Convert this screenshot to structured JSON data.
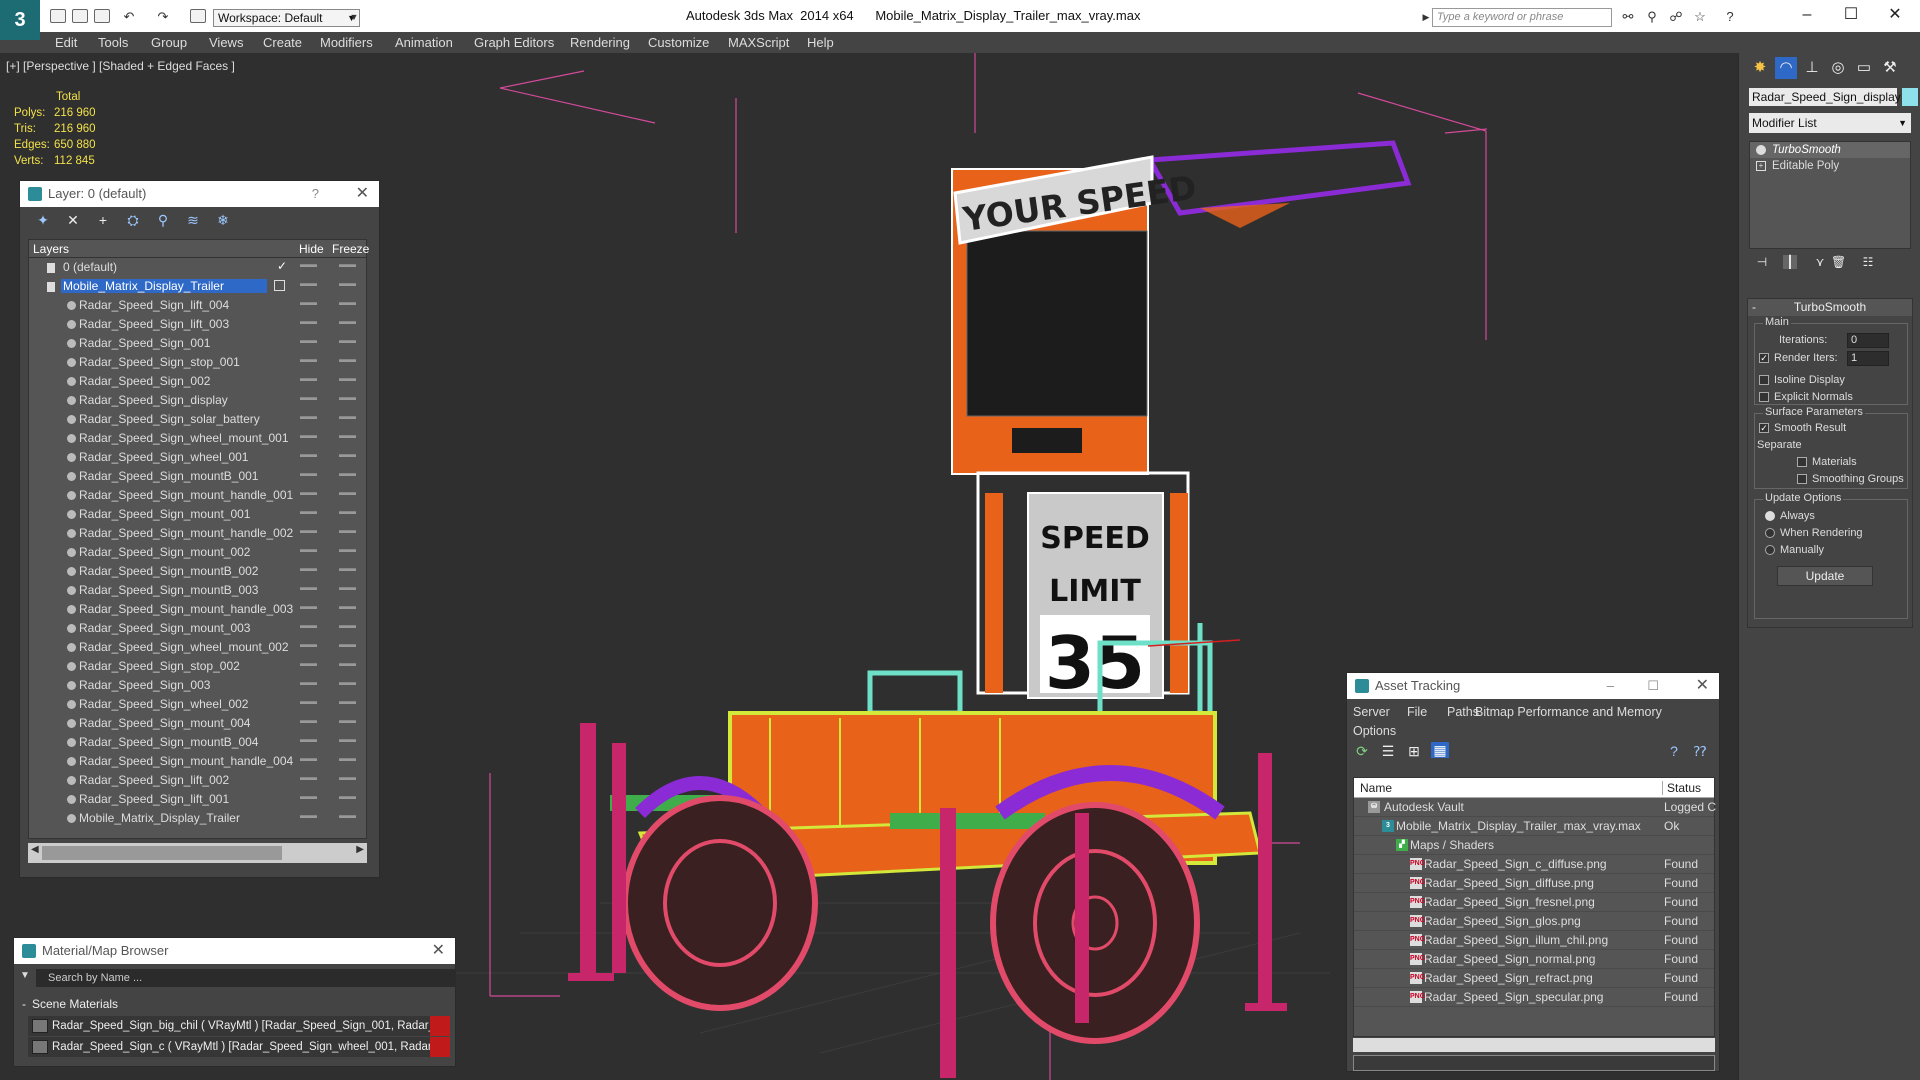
{
  "titlebar": {
    "workspace": "Workspace: Default",
    "app_name": "Autodesk 3ds Max  2014 x64",
    "file_name": "Mobile_Matrix_Display_Trailer_max_vray.max",
    "search_placeholder": "Type a keyword or phrase"
  },
  "menu": [
    "Edit",
    "Tools",
    "Group",
    "Views",
    "Create",
    "Modifiers",
    "Animation",
    "Graph Editors",
    "Rendering",
    "Customize",
    "MAXScript",
    "Help"
  ],
  "viewport": {
    "label": "[+] [Perspective ] [Shaded + Edged Faces ]",
    "stats": {
      "header": "Total",
      "polys_label": "Polys:",
      "polys": "216 960",
      "tris_label": "Tris:",
      "tris": "216 960",
      "edges_label": "Edges:",
      "edges": "650 880",
      "verts_label": "Verts:",
      "verts": "112 845"
    },
    "sign_top": "YOUR SPEED",
    "sign_limit_1": "SPEED",
    "sign_limit_2": "LIMIT",
    "sign_number": "35"
  },
  "layer_panel": {
    "title": "Layer: 0 (default)",
    "help": "?",
    "col_layers": "Layers",
    "col_hide": "Hide",
    "col_freeze": "Freeze",
    "layers": [
      {
        "name": "0 (default)"
      },
      {
        "name": "Mobile_Matrix_Display_Trailer"
      }
    ],
    "objects": [
      "Radar_Speed_Sign_lift_004",
      "Radar_Speed_Sign_lift_003",
      "Radar_Speed_Sign_001",
      "Radar_Speed_Sign_stop_001",
      "Radar_Speed_Sign_002",
      "Radar_Speed_Sign_display",
      "Radar_Speed_Sign_solar_battery",
      "Radar_Speed_Sign_wheel_mount_001",
      "Radar_Speed_Sign_wheel_001",
      "Radar_Speed_Sign_mountB_001",
      "Radar_Speed_Sign_mount_handle_001",
      "Radar_Speed_Sign_mount_001",
      "Radar_Speed_Sign_mount_handle_002",
      "Radar_Speed_Sign_mount_002",
      "Radar_Speed_Sign_mountB_002",
      "Radar_Speed_Sign_mountB_003",
      "Radar_Speed_Sign_mount_handle_003",
      "Radar_Speed_Sign_mount_003",
      "Radar_Speed_Sign_wheel_mount_002",
      "Radar_Speed_Sign_stop_002",
      "Radar_Speed_Sign_003",
      "Radar_Speed_Sign_wheel_002",
      "Radar_Speed_Sign_mount_004",
      "Radar_Speed_Sign_mountB_004",
      "Radar_Speed_Sign_mount_handle_004",
      "Radar_Speed_Sign_lift_002",
      "Radar_Speed_Sign_lift_001",
      "Mobile_Matrix_Display_Trailer"
    ]
  },
  "material_browser": {
    "title": "Material/Map Browser",
    "search_placeholder": "Search by Name ...",
    "group": "Scene Materials",
    "materials": [
      "Radar_Speed_Sign_big_chil  ( VRayMtl ) [Radar_Speed_Sign_001, Radar_...",
      "Radar_Speed_Sign_c  ( VRayMtl ) [Radar_Speed_Sign_wheel_001, Radar_..."
    ]
  },
  "asset_tracking": {
    "title": "Asset Tracking",
    "menu": [
      "Server",
      "File",
      "Paths",
      "Bitmap Performance and Memory",
      "Options"
    ],
    "col_name": "Name",
    "col_status": "Status",
    "rows": [
      {
        "name": "Autodesk Vault",
        "status": "Logged C"
      },
      {
        "name": "Mobile_Matrix_Display_Trailer_max_vray.max",
        "status": "Ok"
      },
      {
        "name": "Maps / Shaders",
        "status": ""
      },
      {
        "name": "Radar_Speed_Sign_c_diffuse.png",
        "status": "Found"
      },
      {
        "name": "Radar_Speed_Sign_diffuse.png",
        "status": "Found"
      },
      {
        "name": "Radar_Speed_Sign_fresnel.png",
        "status": "Found"
      },
      {
        "name": "Radar_Speed_Sign_glos.png",
        "status": "Found"
      },
      {
        "name": "Radar_Speed_Sign_illum_chil.png",
        "status": "Found"
      },
      {
        "name": "Radar_Speed_Sign_normal.png",
        "status": "Found"
      },
      {
        "name": "Radar_Speed_Sign_refract.png",
        "status": "Found"
      },
      {
        "name": "Radar_Speed_Sign_specular.png",
        "status": "Found"
      }
    ]
  },
  "command_panel": {
    "object_name": "Radar_Speed_Sign_display",
    "modifier_list": "Modifier List",
    "stack": [
      "TurboSmooth",
      "Editable Poly"
    ],
    "rollout_title": "TurboSmooth",
    "main_label": "Main",
    "iterations_label": "Iterations:",
    "iterations": "0",
    "render_iters_label": "Render Iters:",
    "render_iters": "1",
    "isoline": "Isoline Display",
    "explicit_normals": "Explicit Normals",
    "surface_params": "Surface Parameters",
    "smooth_result": "Smooth Result",
    "separate": "Separate",
    "materials": "Materials",
    "smoothing_groups": "Smoothing Groups",
    "update_options": "Update Options",
    "always": "Always",
    "when_rendering": "When Rendering",
    "manually": "Manually",
    "update_btn": "Update"
  },
  "colors": {
    "orange": "#e8621a",
    "magenta": "#d6276a",
    "cyan": "#6fe0c8",
    "purple": "#8a2bd6",
    "selection": "#2f69c7",
    "stats_yellow": "#f2e14a"
  }
}
